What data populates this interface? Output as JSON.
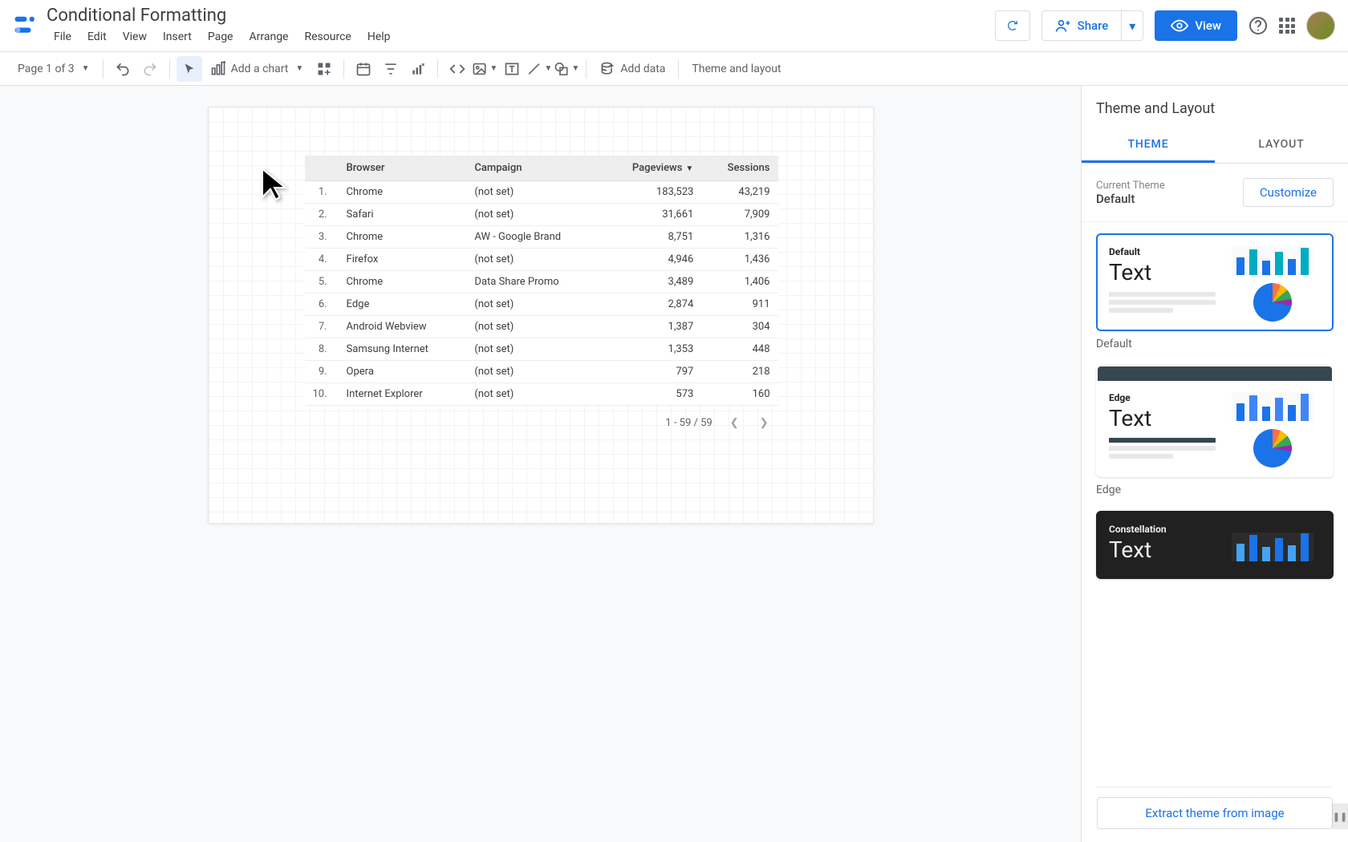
{
  "header": {
    "doc_title": "Conditional Formatting",
    "menu": [
      "File",
      "Edit",
      "View",
      "Insert",
      "Page",
      "Arrange",
      "Resource",
      "Help"
    ],
    "share_label": "Share",
    "view_label": "View"
  },
  "toolbar": {
    "page_label": "Page 1 of 3",
    "add_chart_label": "Add a chart",
    "add_data_label": "Add data",
    "theme_layout_label": "Theme and layout"
  },
  "table": {
    "headers": {
      "browser": "Browser",
      "campaign": "Campaign",
      "pageviews": "Pageviews",
      "sessions": "Sessions"
    },
    "rows": [
      {
        "idx": "1.",
        "browser": "Chrome",
        "campaign": "(not set)",
        "pageviews": "183,523",
        "sessions": "43,219"
      },
      {
        "idx": "2.",
        "browser": "Safari",
        "campaign": "(not set)",
        "pageviews": "31,661",
        "sessions": "7,909"
      },
      {
        "idx": "3.",
        "browser": "Chrome",
        "campaign": "AW - Google Brand",
        "pageviews": "8,751",
        "sessions": "1,316"
      },
      {
        "idx": "4.",
        "browser": "Firefox",
        "campaign": "(not set)",
        "pageviews": "4,946",
        "sessions": "1,436"
      },
      {
        "idx": "5.",
        "browser": "Chrome",
        "campaign": "Data Share Promo",
        "pageviews": "3,489",
        "sessions": "1,406"
      },
      {
        "idx": "6.",
        "browser": "Edge",
        "campaign": "(not set)",
        "pageviews": "2,874",
        "sessions": "911"
      },
      {
        "idx": "7.",
        "browser": "Android Webview",
        "campaign": "(not set)",
        "pageviews": "1,387",
        "sessions": "304"
      },
      {
        "idx": "8.",
        "browser": "Samsung Internet",
        "campaign": "(not set)",
        "pageviews": "1,353",
        "sessions": "448"
      },
      {
        "idx": "9.",
        "browser": "Opera",
        "campaign": "(not set)",
        "pageviews": "797",
        "sessions": "218"
      },
      {
        "idx": "10.",
        "browser": "Internet Explorer",
        "campaign": "(not set)",
        "pageviews": "573",
        "sessions": "160"
      }
    ],
    "pager": "1 - 59 / 59"
  },
  "panel": {
    "title": "Theme and Layout",
    "tab_theme": "THEME",
    "tab_layout": "LAYOUT",
    "current_label": "Current Theme",
    "current_name": "Default",
    "customize_label": "Customize",
    "themes": [
      {
        "name": "Default",
        "label": "Default"
      },
      {
        "name": "Edge",
        "label": "Edge"
      },
      {
        "name": "Constellation",
        "label": "Constellation"
      }
    ],
    "text_sample": "Text",
    "extract_label": "Extract theme from image"
  }
}
